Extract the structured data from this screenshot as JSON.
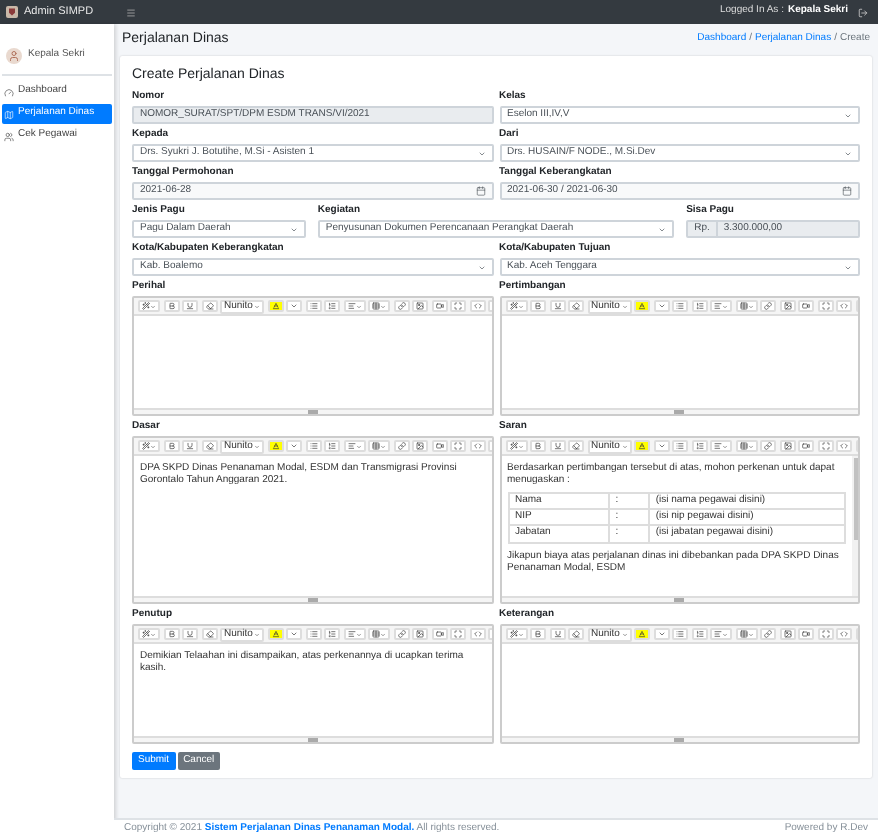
{
  "navbar": {
    "brand": "Admin SIMPD",
    "logged_in_label": "Logged In As :",
    "user": "Kepala Sekri"
  },
  "sidebar": {
    "user": "Kepala Sekri",
    "items": [
      {
        "label": "Dashboard",
        "selected": false
      },
      {
        "label": "Perjalanan Dinas",
        "selected": true
      },
      {
        "label": "Cek Pegawai",
        "selected": false
      }
    ]
  },
  "page": {
    "title": "Perjalanan Dinas",
    "separator": "/",
    "breadcrumbs": [
      {
        "label": "Dashboard",
        "kind": "link"
      },
      {
        "label": "Perjalanan Dinas",
        "kind": "link"
      },
      {
        "label": "Create",
        "kind": "current"
      }
    ]
  },
  "form": {
    "title": "Create Perjalanan Dinas",
    "rows": [
      [
        {
          "label": "Nomor",
          "kind": "text",
          "value": "NOMOR_SURAT/SPT/DPM ESDM TRANS/VI/2021",
          "disabled": true
        },
        {
          "label": "Kelas",
          "kind": "select",
          "value": "Eselon III,IV,V",
          "disabled": false
        }
      ],
      [
        {
          "label": "Kepada",
          "kind": "select",
          "value": "Drs. Syukri J. Botutihe, M.Si - Asisten 1",
          "disabled": false
        },
        {
          "label": "Dari",
          "kind": "select",
          "value": "Drs. HUSAIN/F NODE., M.Si.Dev",
          "disabled": false
        }
      ],
      [
        {
          "label": "Tanggal Permohonan",
          "kind": "date",
          "value": "2021-06-28",
          "disabled": false
        },
        {
          "label": "Tanggal Keberangkatan",
          "kind": "date",
          "value": "2021-06-30 / 2021-06-30",
          "disabled": false
        }
      ],
      [
        {
          "label": "Jenis Pagu",
          "kind": "select",
          "value": "Pagu Dalam Daerah",
          "disabled": false
        },
        {
          "label": "Kegiatan",
          "kind": "select",
          "value": "Penyusunan Dokumen Perencanaan Perangkat Daerah",
          "disabled": false
        },
        {
          "label": "Sisa Pagu",
          "kind": "money",
          "prefix": "Rp.",
          "value": "3.300.000,00",
          "disabled": true
        }
      ],
      [
        {
          "label": "Kota/Kabupaten Keberangkatan",
          "kind": "select",
          "value": "Kab. Boalemo",
          "disabled": false
        },
        {
          "label": "Kota/Kabupaten Tujuan",
          "kind": "select",
          "value": "Kab. Aceh Tenggara",
          "disabled": false
        }
      ]
    ],
    "editor_rows": [
      [
        {
          "label": "Perihal",
          "font": "Nunito"
        },
        {
          "label": "Pertimbangan",
          "font": "Nunito"
        }
      ],
      [
        {
          "label": "Dasar",
          "font": "Nunito",
          "content": [
            {
              "kind": "paragraph",
              "text": "DPA SKPD Dinas Penanaman Modal, ESDM dan Transmigrasi Provinsi Gorontalo Tahun Anggaran 2021."
            }
          ]
        },
        {
          "label": "Saran",
          "font": "Nunito",
          "scrollbar": true,
          "content": [
            {
              "kind": "paragraph",
              "text": "Berdasarkan pertimbangan tersebut di atas, mohon perkenan untuk dapat menugaskan :"
            },
            {
              "kind": "table",
              "rows": [
                [
                  "Nama",
                  ":",
                  "(isi nama pegawai disini)"
                ],
                [
                  "NIP",
                  ":",
                  "(isi nip pegawai disini)"
                ],
                [
                  "Jabatan",
                  ":",
                  "(isi jabatan pegawai disini)"
                ]
              ]
            },
            {
              "kind": "paragraph",
              "text": "Jikapun biaya atas perjalanan dinas ini dibebankan pada DPA SKPD Dinas Penanaman Modal, ESDM"
            }
          ]
        }
      ],
      [
        {
          "label": "Penutup",
          "font": "Nunito",
          "content": [
            {
              "kind": "paragraph",
              "text": "Demikian Telaahan ini disampaikan, atas perkenannya di ucapkan terima kasih."
            }
          ]
        },
        {
          "label": "Keterangan",
          "font": "Nunito"
        }
      ]
    ],
    "buttons": [
      {
        "label": "Submit",
        "kind": "primary"
      },
      {
        "label": "Cancel",
        "kind": "secondary"
      }
    ]
  },
  "footer": {
    "prefix": "Copyright © 2021",
    "link": "Sistem Perjalanan Dinas Penanaman Modal.",
    "suffix": "All rights reserved.",
    "powered": "Powered by R.Dev"
  }
}
